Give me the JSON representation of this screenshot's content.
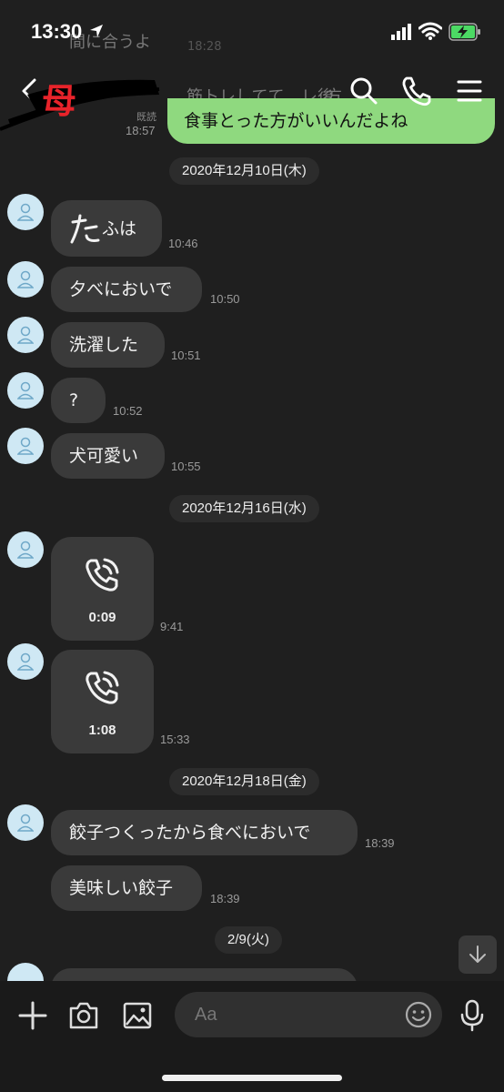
{
  "status_bar": {
    "time": "13:30"
  },
  "header": {
    "contact_name": "母"
  },
  "previous": {
    "ghost_line1": "間に合うよ",
    "ghost_time": "18:28",
    "ghost_line2": "筋トレしてて、",
    "ghost_line3": "レ後",
    "ghost_line4": "方",
    "read_label": "既読",
    "bubble_text": "食事とった方がいいんだよね",
    "time": "18:57"
  },
  "messages": {
    "date1": "2020年12月10日(木)",
    "m1_text": "ふは",
    "m1_time": "10:46",
    "m2_text": "夕べにおいで",
    "m2_time": "10:50",
    "m3_text": "洗濯した",
    "m3_time": "10:51",
    "m4_text": "?",
    "m4_time": "10:52",
    "m5_text": "犬可愛い",
    "m5_time": "10:55",
    "date2": "2020年12月16日(水)",
    "c1_duration": "0:09",
    "c1_time": "9:41",
    "c2_duration": "1:08",
    "c2_time": "15:33",
    "date3": "2020年12月18日(金)",
    "m6_text": "餃子つくったから食べにおいで",
    "m6_time": "18:39",
    "m7_text": "美味しい餃子",
    "m7_time": "18:39",
    "date4": "2/9(火)"
  },
  "input": {
    "placeholder": "Aa"
  }
}
